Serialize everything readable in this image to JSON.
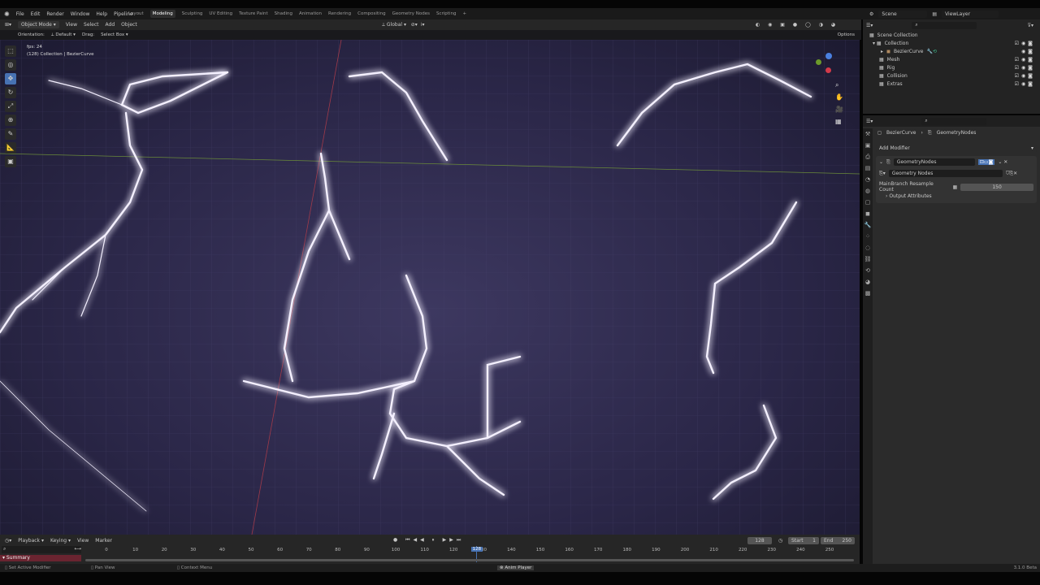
{
  "menu": [
    "File",
    "Edit",
    "Render",
    "Window",
    "Help",
    "Pipeline"
  ],
  "workspaces": [
    "Layout",
    "Modeling",
    "Sculpting",
    "UV Editing",
    "Texture Paint",
    "Shading",
    "Animation",
    "Rendering",
    "Compositing",
    "Geometry Nodes",
    "Scripting",
    "+"
  ],
  "active_workspace": "Modeling",
  "header": {
    "mode": "Object Mode",
    "view": "View",
    "select": "Select",
    "add": "Add",
    "object": "Object",
    "transform": "Global",
    "options": "Options"
  },
  "tool_settings": {
    "orientation_label": "Orientation:",
    "orientation": "Default",
    "drag_label": "Drag:",
    "drag": "Select Box"
  },
  "viewport": {
    "fps": "fps: 24",
    "context": "(128) Collection | BezierCurve"
  },
  "outliner": {
    "scene": "Scene",
    "view_layer": "ViewLayer",
    "items": [
      "Scene Collection",
      "Collection",
      "BezierCurve",
      "Mesh",
      "Rig",
      "Collision",
      "Extras"
    ]
  },
  "properties": {
    "breadcrumb_object": "BezierCurve",
    "breadcrumb_modifier": "GeometryNodes",
    "add_modifier": "Add Modifier",
    "modifier_name": "GeometryNodes",
    "node_group": "Geometry Nodes",
    "input_label": "MainBranch Resample Count",
    "input_value": "150",
    "output_attributes": "Output Attributes"
  },
  "timeline": {
    "menus": [
      "Playback",
      "Keying",
      "View",
      "Marker"
    ],
    "current_frame": "128",
    "start_label": "Start",
    "start": "1",
    "end_label": "End",
    "end": "250",
    "summary": "Summary",
    "ticks": [
      0,
      10,
      20,
      30,
      40,
      50,
      60,
      70,
      80,
      90,
      100,
      110,
      120,
      130,
      140,
      150,
      160,
      170,
      180,
      190,
      200,
      210,
      220,
      230,
      240,
      250
    ]
  },
  "status": {
    "left": "Set Active Modifier",
    "middle": "Pan View",
    "right": "Context Menu",
    "anim": "Anim Player",
    "version": "3.1.0 Beta"
  },
  "colors": {
    "accent": "#4772b3",
    "bolt": "#f4f0ff",
    "glow": "#8f7cff"
  }
}
